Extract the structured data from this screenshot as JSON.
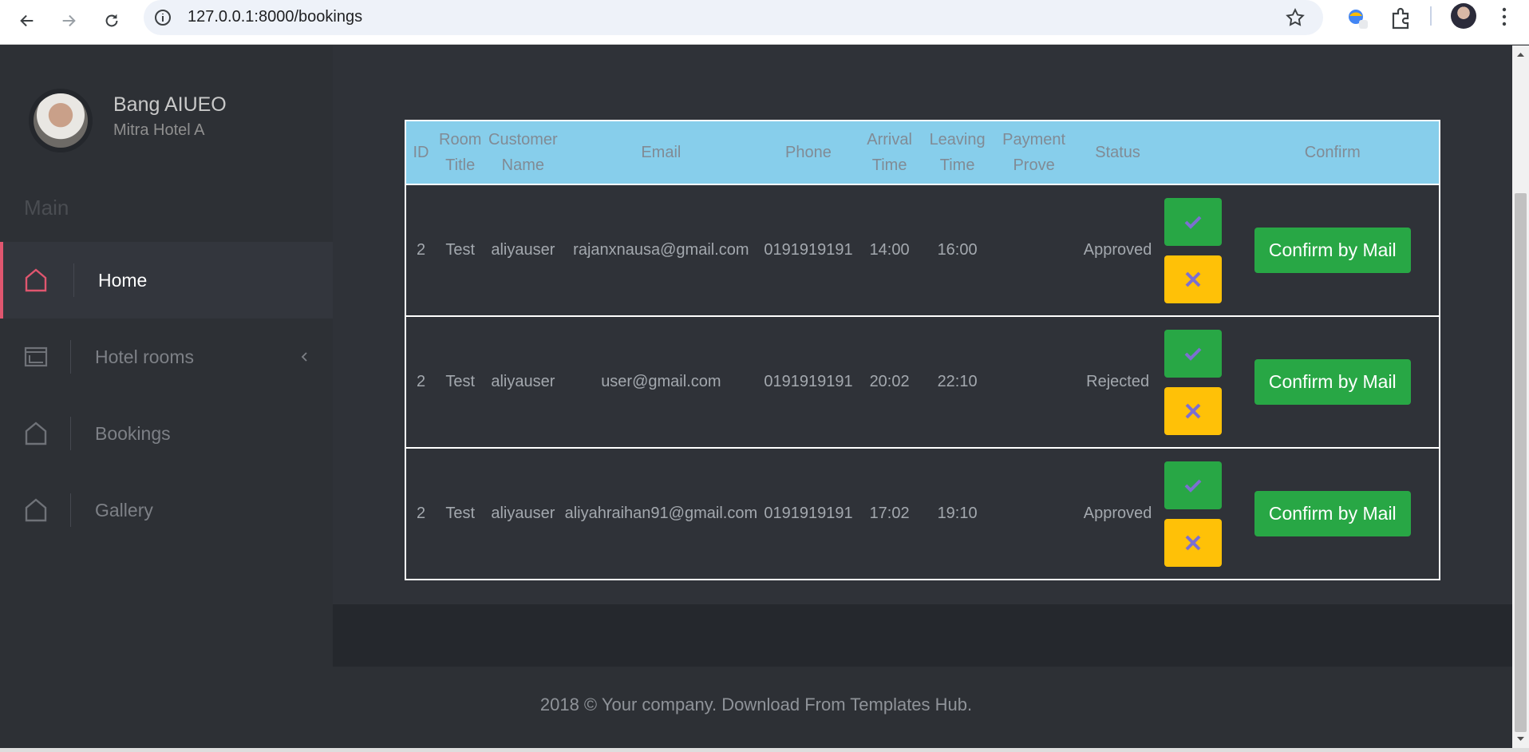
{
  "browser": {
    "url": "127.0.0.1:8000/bookings"
  },
  "sidebar": {
    "user_name": "Bang AIUEO",
    "user_subtitle": "Mitra Hotel A",
    "section_label": "Main",
    "items": [
      {
        "label": "Home",
        "icon": "home-icon",
        "active": true
      },
      {
        "label": "Hotel rooms",
        "icon": "window-icon",
        "has_submenu": true
      },
      {
        "label": "Bookings",
        "icon": "home-icon"
      },
      {
        "label": "Gallery",
        "icon": "home-icon"
      }
    ]
  },
  "table": {
    "headers": [
      {
        "line1": "ID",
        "line2": ""
      },
      {
        "line1": "Room",
        "line2": "Title"
      },
      {
        "line1": "Customer",
        "line2": "Name"
      },
      {
        "line1": "Email",
        "line2": ""
      },
      {
        "line1": "Phone",
        "line2": ""
      },
      {
        "line1": "Arrival",
        "line2": "Time"
      },
      {
        "line1": "Leaving",
        "line2": "Time"
      },
      {
        "line1": "Payment",
        "line2": "Prove"
      },
      {
        "line1": "Status",
        "line2": ""
      },
      {
        "line1": "",
        "line2": ""
      },
      {
        "line1": "Confirm",
        "line2": ""
      }
    ],
    "rows": [
      {
        "id": "2",
        "room_title": "Test",
        "customer_name": "aliyauser",
        "email": "rajanxnausa@gmail.com",
        "phone": "0191919191",
        "arrival": "14:00",
        "leaving": "16:00",
        "payment": "",
        "status": "Approved",
        "confirm_label": "Confirm by Mail"
      },
      {
        "id": "2",
        "room_title": "Test",
        "customer_name": "aliyauser",
        "email": "user@gmail.com",
        "phone": "0191919191",
        "arrival": "20:02",
        "leaving": "22:10",
        "payment": "",
        "status": "Rejected",
        "confirm_label": "Confirm by Mail"
      },
      {
        "id": "2",
        "room_title": "Test",
        "customer_name": "aliyauser",
        "email": "aliyahraihan91@gmail.com",
        "phone": "0191919191",
        "arrival": "17:02",
        "leaving": "19:10",
        "payment": "",
        "status": "Approved",
        "confirm_label": "Confirm by Mail"
      }
    ]
  },
  "footer": {
    "text": "2018 © Your company. Download From Templates Hub."
  },
  "colors": {
    "accent_active": "#e0566f",
    "header_bg": "#87ceeb",
    "approve_btn": "#28a745",
    "reject_btn": "#ffc107",
    "status_approved": "#87ceeb",
    "status_rejected": "#ff1a1a"
  }
}
